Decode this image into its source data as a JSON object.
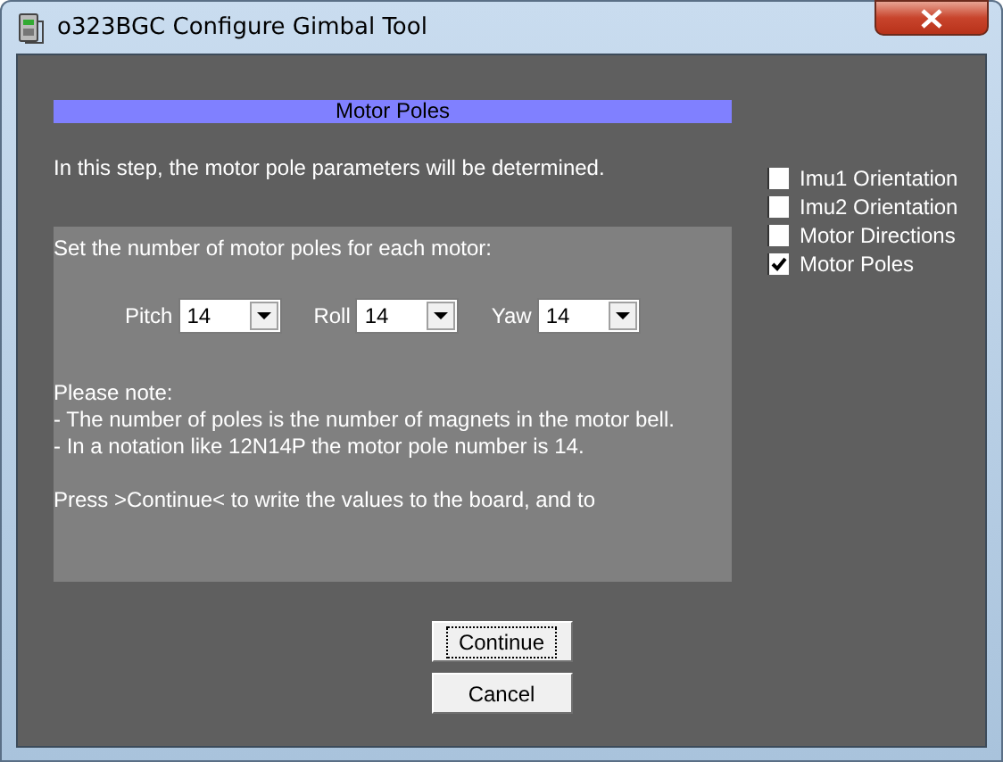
{
  "window": {
    "title": "o323BGC Configure Gimbal Tool"
  },
  "header": "Motor Poles",
  "intro": "In this step, the motor pole parameters will be determined.",
  "panel": {
    "heading": "Set the number of motor poles for each motor:",
    "selectors": [
      {
        "label": "Pitch",
        "value": "14"
      },
      {
        "label": "Roll",
        "value": "14"
      },
      {
        "label": "Yaw",
        "value": "14"
      }
    ],
    "notes": [
      [
        "Please note:",
        "- The number of poles is the number of magnets in the motor bell.",
        "- In a notation like 12N14P the motor pole number is 14."
      ],
      [
        "Press >Continue< to write the values to the board, and to"
      ]
    ]
  },
  "steps": [
    {
      "label": "Imu1 Orientation",
      "checked": false
    },
    {
      "label": "Imu2 Orientation",
      "checked": false
    },
    {
      "label": "Motor Directions",
      "checked": false
    },
    {
      "label": "Motor Poles",
      "checked": true
    }
  ],
  "buttons": [
    {
      "label": "Continue",
      "focused": true
    },
    {
      "label": "Cancel",
      "focused": false
    }
  ]
}
